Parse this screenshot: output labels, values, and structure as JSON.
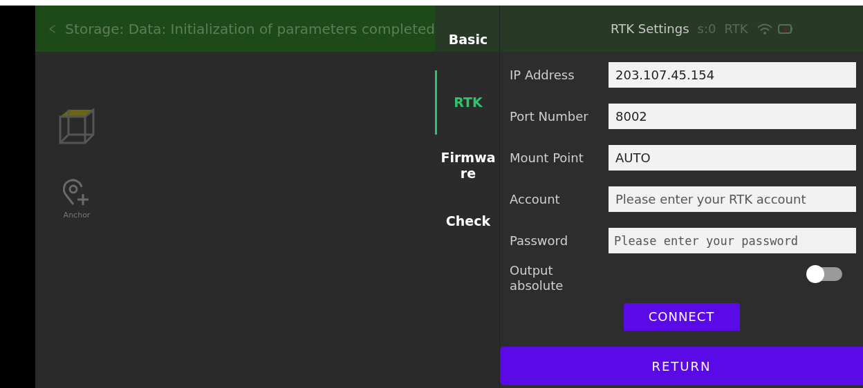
{
  "header": {
    "message": "Storage:  Data:  Initialization of parameters completed",
    "status_texts": [
      "s:0",
      "RTK"
    ]
  },
  "tools": [
    {
      "kind": "cube"
    },
    {
      "kind": "anchor",
      "label": "Anchor"
    }
  ],
  "dialog": {
    "title": "RTK Settings",
    "nav": [
      {
        "label": "Basic",
        "selected": false
      },
      {
        "label": "RTK",
        "selected": true
      },
      {
        "label": "Firmwa re",
        "selected": false
      },
      {
        "label": "Check",
        "selected": false
      }
    ],
    "fields": [
      {
        "label": "IP Address",
        "value": "203.107.45.154"
      },
      {
        "label": "Port Number",
        "value": "8002"
      },
      {
        "label": "Mount Point",
        "value": "AUTO"
      },
      {
        "label": "Account",
        "placeholder": "Please enter your RTK account"
      },
      {
        "label": "Password",
        "placeholder": "Please enter your password",
        "kind": "password"
      }
    ],
    "toggle": {
      "label": "Output absolute",
      "on": false
    },
    "connect": "CONNECT",
    "return": "RETURN"
  }
}
